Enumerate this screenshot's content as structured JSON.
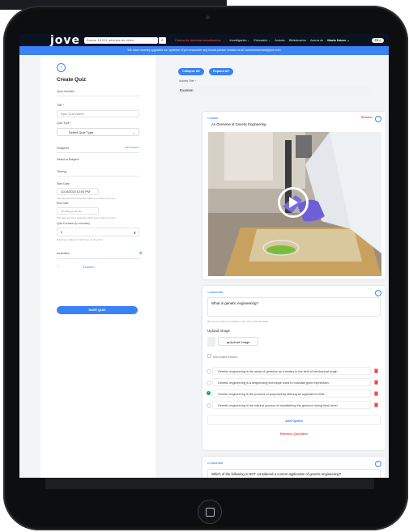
{
  "nav": {
    "logo": "jove",
    "search_placeholder": "Buscar 16,011 artículos de video...",
    "search_icon": "search-icon",
    "highlight": "Centro de recursos académicos",
    "items": [
      "Investigación ⌄",
      "Educación ⌄",
      "Autores",
      "Bibliotecarios",
      "Acerca de"
    ],
    "user": "María Núcar ⌄",
    "lang": "ES ◐"
  },
  "banner": {
    "text": "We have recently upgraded our systems. If you encounter any issues please contact us at: customerservice@jove.com"
  },
  "left": {
    "back_icon": "chevron-left-icon",
    "title": "Create Quiz",
    "details_heading": "Quiz Details",
    "title_label": "Title *",
    "title_placeholder": "Input Quiz Name",
    "type_label": "Quiz Type *",
    "type_value": "Select Quiz Type",
    "subjects_heading": "Subjects",
    "subjects_edit": "Edit Subjects",
    "subject_value": "Select a Subject",
    "timing_heading": "Timing",
    "start_label": "Start Date",
    "start_value": "11/14/2022 12:00 PM",
    "start_help": "The date and time selected reflect your local time zone.",
    "end_label": "End Date",
    "end_placeholder": "mm/dd/yyyy hh:mm",
    "end_help": "The date and time selected reflect your local time zone.",
    "duration_label": "Quiz Duration (in minutes)",
    "duration_value": "0",
    "duration_help": "Entering a value of 0 will have no time limit",
    "activities_heading": "Activities",
    "activity_name": "Examen",
    "save_label": "SAVE QUIZ"
  },
  "right": {
    "collapse_label": "Collapse All",
    "expand_label": "Expand All",
    "activity_title_label": "Activity Title *",
    "activity_title_value": "Examen",
    "video_card": {
      "tag": "VIDEO",
      "title": "An Overview of Genetic Engineering",
      "remove": "Remove"
    },
    "question_card": {
      "tag": "QUESTION",
      "question": "What is genetic engineering?",
      "hint": "Be sure to make your question clear and understandable",
      "upload_heading": "Upload Image",
      "upload_button": "Upload Image",
      "multi_label": "Add multiple answers",
      "answers": [
        "Genetic engineering is the study of genetics as it relates to the field of mechanical engin",
        "Genetic engineering is a sequencing technique used to evaluate gene expression.",
        "Genetic engineering is the process of purposefully altering an organism's DNA.",
        "Genetic engineering is the natural process of establishing the genome during fetal devel"
      ],
      "add_option": "Add Option",
      "remove_question": "Remove Question"
    },
    "question_card2": {
      "tag": "QUESTION",
      "question": "Which of the following is NOT considered a current application of genetic engineering?"
    }
  },
  "colors": {
    "accent": "#3b82f6",
    "danger": "#ef4444",
    "correct": "#16a34a",
    "nav_bg": "#0b1220"
  }
}
